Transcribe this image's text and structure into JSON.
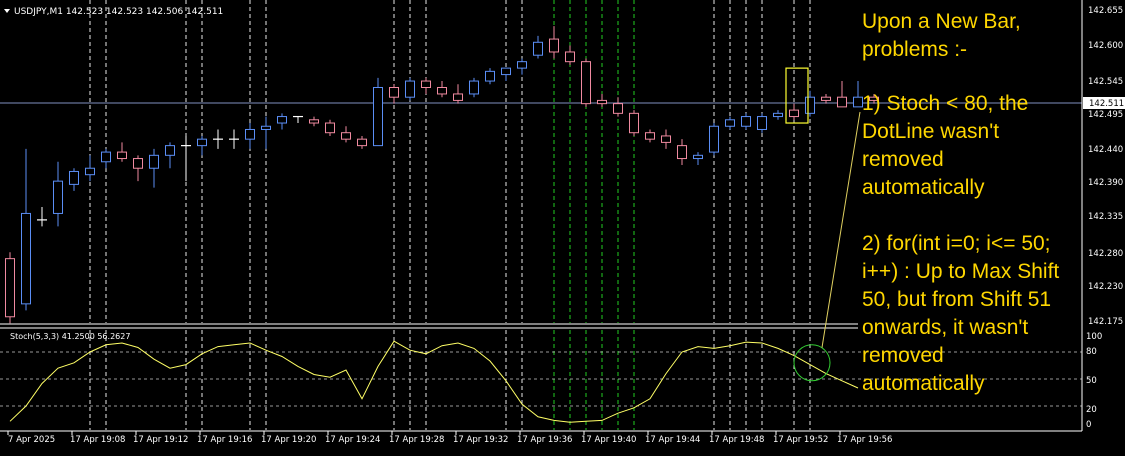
{
  "window": {
    "symbol_line": "USDJPY,M1  142.523 142.523 142.506 142.511",
    "current_price": "142.511"
  },
  "indicator": {
    "label": "Stoch(5,3,3) 41.2500 56.2627",
    "levels": [
      "100",
      "80",
      "50",
      "20",
      "0"
    ]
  },
  "price_axis": {
    "labels": [
      "142.655",
      "142.600",
      "142.545",
      "142.495",
      "142.440",
      "142.390",
      "142.335",
      "142.280",
      "142.230",
      "142.175"
    ]
  },
  "time_axis": {
    "labels": [
      "7 Apr 2025",
      "17 Apr 19:08",
      "17 Apr 19:12",
      "17 Apr 19:16",
      "17 Apr 19:20",
      "17 Apr 19:24",
      "17 Apr 19:28",
      "17 Apr 19:32",
      "17 Apr 19:36",
      "17 Apr 19:40",
      "17 Apr 19:44",
      "17 Apr 19:48",
      "17 Apr 19:52",
      "17 Apr 19:56"
    ]
  },
  "annotation": {
    "heading": "Upon a New Bar, problems :-",
    "point1": "1) Stoch < 80, the DotLine wasn't removed automatically",
    "point2": "2) for(int i=0; i<= 50; i++) : Up to Max Shift 50, but from Shift 51 onwards, it wasn't removed automatically"
  },
  "colors": {
    "bull": "#5b8ef5",
    "bear": "#f08aa0",
    "neutral": "#ffffff",
    "stoch": "#ffff66",
    "annotation": "#ffd700",
    "dot_white": "#e8e8e8",
    "dot_green": "#22cc22",
    "bid_line": "#7f8fbf"
  },
  "candles": [
    {
      "o": 142.18,
      "h": 142.28,
      "l": 142.17,
      "c": 142.27,
      "d": "bear"
    },
    {
      "o": 142.2,
      "h": 142.44,
      "l": 142.19,
      "c": 142.34,
      "d": "bull"
    },
    {
      "o": 142.33,
      "h": 142.35,
      "l": 142.32,
      "c": 142.33,
      "d": "flat"
    },
    {
      "o": 142.34,
      "h": 142.42,
      "l": 142.32,
      "c": 142.39,
      "d": "bull"
    },
    {
      "o": 142.385,
      "h": 142.41,
      "l": 142.375,
      "c": 142.405,
      "d": "bull"
    },
    {
      "o": 142.4,
      "h": 142.43,
      "l": 142.39,
      "c": 142.41,
      "d": "bull"
    },
    {
      "o": 142.42,
      "h": 142.44,
      "l": 142.41,
      "c": 142.435,
      "d": "bull"
    },
    {
      "o": 142.435,
      "h": 142.45,
      "l": 142.42,
      "c": 142.425,
      "d": "bear"
    },
    {
      "o": 142.425,
      "h": 142.43,
      "l": 142.39,
      "c": 142.41,
      "d": "bear"
    },
    {
      "o": 142.41,
      "h": 142.44,
      "l": 142.38,
      "c": 142.43,
      "d": "bull"
    },
    {
      "o": 142.43,
      "h": 142.45,
      "l": 142.41,
      "c": 142.445,
      "d": "bull"
    },
    {
      "o": 142.445,
      "h": 142.46,
      "l": 142.39,
      "c": 142.445,
      "d": "flat"
    },
    {
      "o": 142.445,
      "h": 142.46,
      "l": 142.43,
      "c": 142.455,
      "d": "bull"
    },
    {
      "o": 142.455,
      "h": 142.47,
      "l": 142.44,
      "c": 142.455,
      "d": "flat"
    },
    {
      "o": 142.455,
      "h": 142.47,
      "l": 142.44,
      "c": 142.455,
      "d": "flat"
    },
    {
      "o": 142.455,
      "h": 142.48,
      "l": 142.44,
      "c": 142.47,
      "d": "bull"
    },
    {
      "o": 142.47,
      "h": 142.49,
      "l": 142.44,
      "c": 142.475,
      "d": "bull"
    },
    {
      "o": 142.48,
      "h": 142.495,
      "l": 142.47,
      "c": 142.49,
      "d": "bull"
    },
    {
      "o": 142.49,
      "h": 142.49,
      "l": 142.48,
      "c": 142.49,
      "d": "flat"
    },
    {
      "o": 142.485,
      "h": 142.49,
      "l": 142.475,
      "c": 142.48,
      "d": "bear"
    },
    {
      "o": 142.48,
      "h": 142.485,
      "l": 142.46,
      "c": 142.465,
      "d": "bear"
    },
    {
      "o": 142.465,
      "h": 142.475,
      "l": 142.45,
      "c": 142.455,
      "d": "bear"
    },
    {
      "o": 142.455,
      "h": 142.46,
      "l": 142.44,
      "c": 142.445,
      "d": "bear"
    },
    {
      "o": 142.445,
      "h": 142.55,
      "l": 142.445,
      "c": 142.535,
      "d": "bull"
    },
    {
      "o": 142.535,
      "h": 142.54,
      "l": 142.51,
      "c": 142.52,
      "d": "bear"
    },
    {
      "o": 142.52,
      "h": 142.55,
      "l": 142.515,
      "c": 142.545,
      "d": "bull"
    },
    {
      "o": 142.545,
      "h": 142.55,
      "l": 142.525,
      "c": 142.535,
      "d": "bear"
    },
    {
      "o": 142.535,
      "h": 142.545,
      "l": 142.52,
      "c": 142.525,
      "d": "bear"
    },
    {
      "o": 142.525,
      "h": 142.54,
      "l": 142.51,
      "c": 142.515,
      "d": "bear"
    },
    {
      "o": 142.525,
      "h": 142.55,
      "l": 142.52,
      "c": 142.545,
      "d": "bull"
    },
    {
      "o": 142.545,
      "h": 142.565,
      "l": 142.54,
      "c": 142.56,
      "d": "bull"
    },
    {
      "o": 142.555,
      "h": 142.565,
      "l": 142.545,
      "c": 142.565,
      "d": "bull"
    },
    {
      "o": 142.565,
      "h": 142.58,
      "l": 142.555,
      "c": 142.575,
      "d": "bull"
    },
    {
      "o": 142.585,
      "h": 142.615,
      "l": 142.58,
      "c": 142.605,
      "d": "bull"
    },
    {
      "o": 142.61,
      "h": 142.63,
      "l": 142.58,
      "c": 142.59,
      "d": "bear"
    },
    {
      "o": 142.59,
      "h": 142.6,
      "l": 142.57,
      "c": 142.575,
      "d": "bear"
    },
    {
      "o": 142.575,
      "h": 142.58,
      "l": 142.505,
      "c": 142.51,
      "d": "bear"
    },
    {
      "o": 142.515,
      "h": 142.525,
      "l": 142.505,
      "c": 142.51,
      "d": "bear"
    },
    {
      "o": 142.51,
      "h": 142.52,
      "l": 142.49,
      "c": 142.495,
      "d": "bear"
    },
    {
      "o": 142.495,
      "h": 142.5,
      "l": 142.46,
      "c": 142.465,
      "d": "bear"
    },
    {
      "o": 142.465,
      "h": 142.47,
      "l": 142.45,
      "c": 142.455,
      "d": "bear"
    },
    {
      "o": 142.46,
      "h": 142.47,
      "l": 142.44,
      "c": 142.45,
      "d": "bear"
    },
    {
      "o": 142.445,
      "h": 142.455,
      "l": 142.415,
      "c": 142.425,
      "d": "bear"
    },
    {
      "o": 142.425,
      "h": 142.435,
      "l": 142.415,
      "c": 142.43,
      "d": "bull"
    },
    {
      "o": 142.435,
      "h": 142.48,
      "l": 142.43,
      "c": 142.475,
      "d": "bull"
    },
    {
      "o": 142.475,
      "h": 142.49,
      "l": 142.47,
      "c": 142.485,
      "d": "bull"
    },
    {
      "o": 142.475,
      "h": 142.495,
      "l": 142.47,
      "c": 142.49,
      "d": "bull"
    },
    {
      "o": 142.47,
      "h": 142.495,
      "l": 142.465,
      "c": 142.49,
      "d": "bull"
    },
    {
      "o": 142.49,
      "h": 142.5,
      "l": 142.485,
      "c": 142.495,
      "d": "bull"
    },
    {
      "o": 142.5,
      "h": 142.51,
      "l": 142.485,
      "c": 142.49,
      "d": "bear"
    },
    {
      "o": 142.495,
      "h": 142.53,
      "l": 142.49,
      "c": 142.52,
      "d": "bull"
    },
    {
      "o": 142.52,
      "h": 142.525,
      "l": 142.51,
      "c": 142.515,
      "d": "bear"
    },
    {
      "o": 142.52,
      "h": 142.545,
      "l": 142.505,
      "c": 142.505,
      "d": "bear"
    },
    {
      "o": 142.505,
      "h": 142.545,
      "l": 142.505,
      "c": 142.52,
      "d": "bull"
    },
    {
      "o": 142.52,
      "h": 142.525,
      "l": 142.51,
      "c": 142.515,
      "d": "bear"
    }
  ],
  "stoch": [
    3,
    20,
    45,
    62,
    68,
    80,
    88,
    90,
    85,
    72,
    62,
    66,
    78,
    86,
    88,
    90,
    82,
    75,
    64,
    55,
    52,
    60,
    28,
    64,
    92,
    82,
    78,
    87,
    90,
    84,
    70,
    48,
    22,
    8,
    4,
    2,
    3,
    4,
    12,
    18,
    28,
    56,
    80,
    86,
    84,
    87,
    91,
    90,
    84,
    76,
    66,
    56,
    48,
    40
  ],
  "dotlines": [
    {
      "i": 5,
      "c": "w"
    },
    {
      "i": 6,
      "c": "w"
    },
    {
      "i": 11,
      "c": "w"
    },
    {
      "i": 12,
      "c": "w"
    },
    {
      "i": 15,
      "c": "w"
    },
    {
      "i": 16,
      "c": "w"
    },
    {
      "i": 24,
      "c": "w"
    },
    {
      "i": 25,
      "c": "w"
    },
    {
      "i": 26,
      "c": "w"
    },
    {
      "i": 31,
      "c": "w"
    },
    {
      "i": 32,
      "c": "w"
    },
    {
      "i": 34,
      "c": "g"
    },
    {
      "i": 35,
      "c": "g"
    },
    {
      "i": 36,
      "c": "g"
    },
    {
      "i": 37,
      "c": "g"
    },
    {
      "i": 38,
      "c": "g"
    },
    {
      "i": 39,
      "c": "g"
    },
    {
      "i": 44,
      "c": "w"
    },
    {
      "i": 45,
      "c": "w"
    },
    {
      "i": 46,
      "c": "w"
    },
    {
      "i": 47,
      "c": "w"
    },
    {
      "i": 49,
      "c": "w"
    },
    {
      "i": 50,
      "c": "w"
    }
  ]
}
